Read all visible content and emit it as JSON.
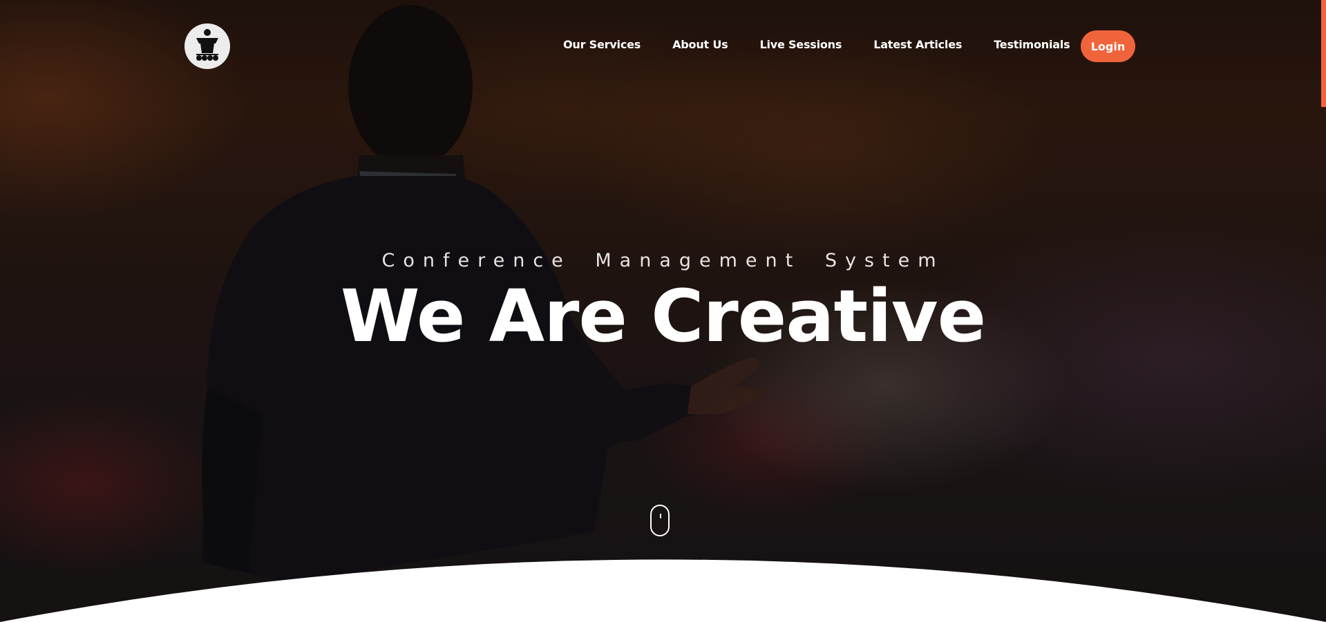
{
  "nav": {
    "links": [
      "Our Services",
      "About Us",
      "Live Sessions",
      "Latest Articles",
      "Testimonials"
    ],
    "login_label": "Login"
  },
  "hero": {
    "subtitle": "Conference Management System",
    "title": "We Are Creative"
  },
  "icons": {
    "logo": "conference-logo-icon",
    "scroll": "mouse-scroll-icon"
  },
  "colors": {
    "accent": "#f0643c",
    "text": "#ffffff",
    "background": "#ffffff"
  }
}
